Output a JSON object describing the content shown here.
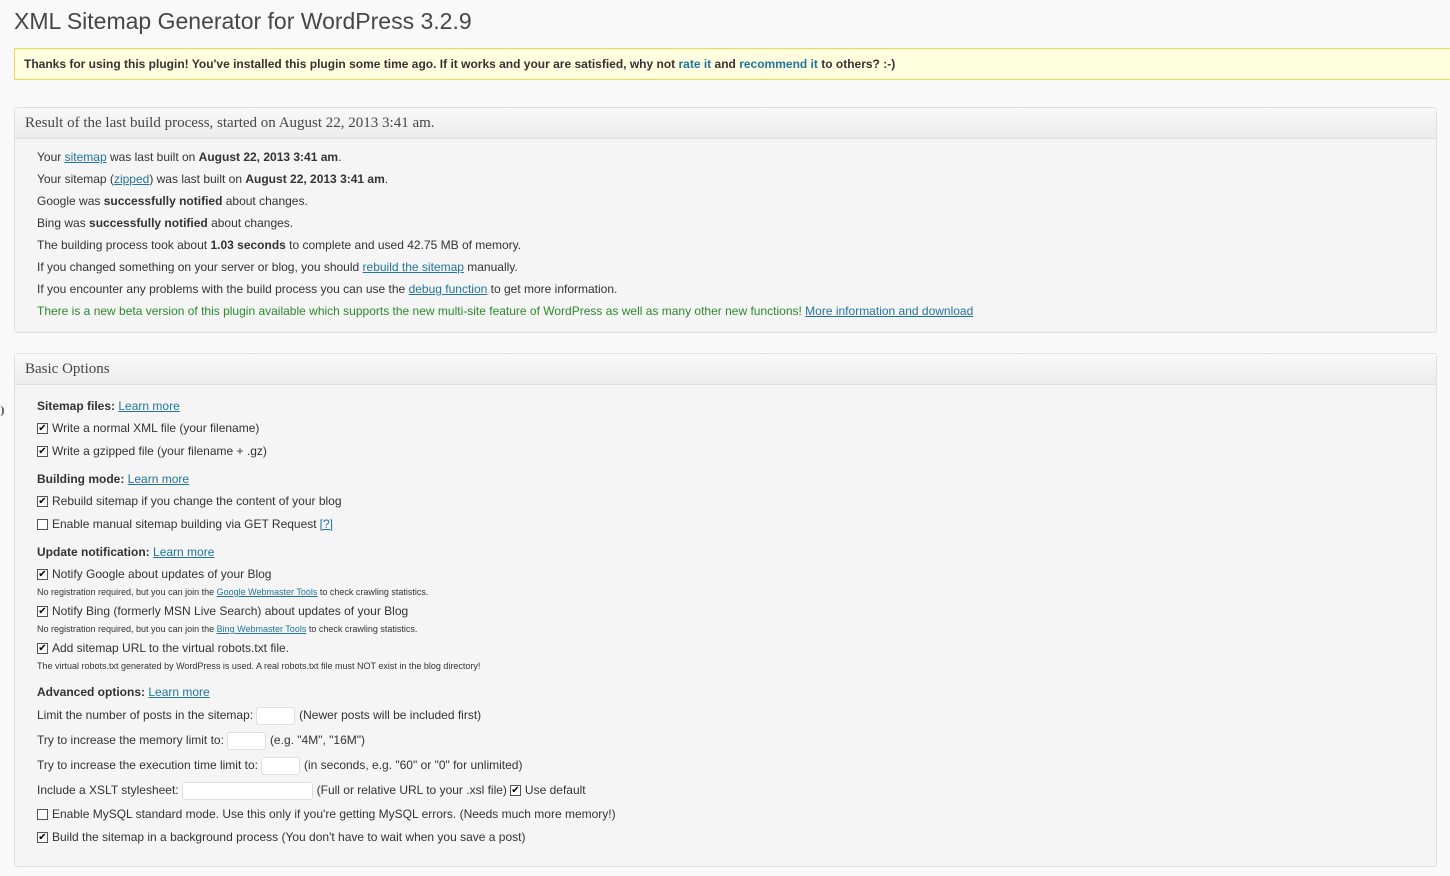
{
  "page": {
    "title": "XML Sitemap Generator for WordPress 3.2.9"
  },
  "notice": {
    "text_before": "Thanks for using this plugin! You've installed this plugin some time ago. If it works and your are satisfied, why not ",
    "rate_link": "rate it",
    "text_mid": " and ",
    "recommend_link": "recommend it",
    "text_after": " to others? :-)"
  },
  "results": {
    "heading": "Result of the last build process, started on August 22, 2013 3:41 am.",
    "line1": {
      "a": "Your ",
      "link": "sitemap",
      "b": " was last built on ",
      "bold": "August 22, 2013 3:41 am",
      "c": "."
    },
    "line2": {
      "a": "Your sitemap (",
      "link": "zipped",
      "b": ") was last built on ",
      "bold": "August 22, 2013 3:41 am",
      "c": "."
    },
    "line3": {
      "a": "Google was ",
      "bold": "successfully notified",
      "b": " about changes."
    },
    "line4": {
      "a": "Bing was ",
      "bold": "successfully notified",
      "b": " about changes."
    },
    "line5": {
      "a": "The building process took about ",
      "bold": "1.03 seconds",
      "b": " to complete and used 42.75 MB of memory."
    },
    "line6": {
      "a": "If you changed something on your server or blog, you should ",
      "link": "rebuild the sitemap",
      "b": " manually."
    },
    "line7": {
      "a": "If you encounter any problems with the build process you can use the ",
      "link": "debug function",
      "b": " to get more information."
    },
    "line8": {
      "a": "There is a new beta version of this plugin available which supports the new multi-site feature of WordPress as well as many other new functions! ",
      "link": "More information and download"
    }
  },
  "basic": {
    "heading": "Basic Options",
    "learn_more": "Learn more",
    "sitemap_files": {
      "title": "Sitemap files:",
      "opt1": {
        "label": "Write a normal XML file (your filename)",
        "checked": true
      },
      "opt2": {
        "label": "Write a gzipped file (your filename + .gz)",
        "checked": true
      }
    },
    "building_mode": {
      "title": "Building mode:",
      "opt1": {
        "label": "Rebuild sitemap if you change the content of your blog",
        "checked": true
      },
      "opt2": {
        "label": "Enable manual sitemap building via GET Request ",
        "help": "[?]",
        "checked": false
      }
    },
    "update_notification": {
      "title": "Update notification:",
      "opt1": {
        "label": "Notify Google about updates of your Blog",
        "checked": true
      },
      "hint1": {
        "a": "No registration required, but you can join the ",
        "link": "Google Webmaster Tools",
        "b": " to check crawling statistics."
      },
      "opt2": {
        "label": "Notify Bing (formerly MSN Live Search) about updates of your Blog",
        "checked": true
      },
      "hint2": {
        "a": "No registration required, but you can join the ",
        "link": "Bing Webmaster Tools",
        "b": " to check crawling statistics."
      },
      "opt3": {
        "label": "Add sitemap URL to the virtual robots.txt file.",
        "checked": true
      },
      "hint3": "The virtual robots.txt generated by WordPress is used. A real robots.txt file must NOT exist in the blog directory!"
    },
    "advanced": {
      "title": "Advanced options:",
      "limit_posts": {
        "label": "Limit the number of posts in the sitemap:",
        "value": "",
        "note": "(Newer posts will be included first)"
      },
      "memory": {
        "label": "Try to increase the memory limit to:",
        "value": "",
        "note": "(e.g. \"4M\", \"16M\")"
      },
      "exec_time": {
        "label": "Try to increase the execution time limit to:",
        "value": "",
        "note": "(in seconds, e.g. \"60\" or \"0\" for unlimited)"
      },
      "xslt": {
        "label": "Include a XSLT stylesheet:",
        "value": "",
        "note": "(Full or relative URL to your .xsl file)",
        "default_label": "Use default",
        "default_checked": true
      },
      "mysql": {
        "label": "Enable MySQL standard mode. Use this only if you're getting MySQL errors. (Needs much more memory!)",
        "checked": false
      },
      "background": {
        "label": "Build the sitemap in a background process (You don't have to wait when you save a post)",
        "checked": true
      }
    }
  }
}
